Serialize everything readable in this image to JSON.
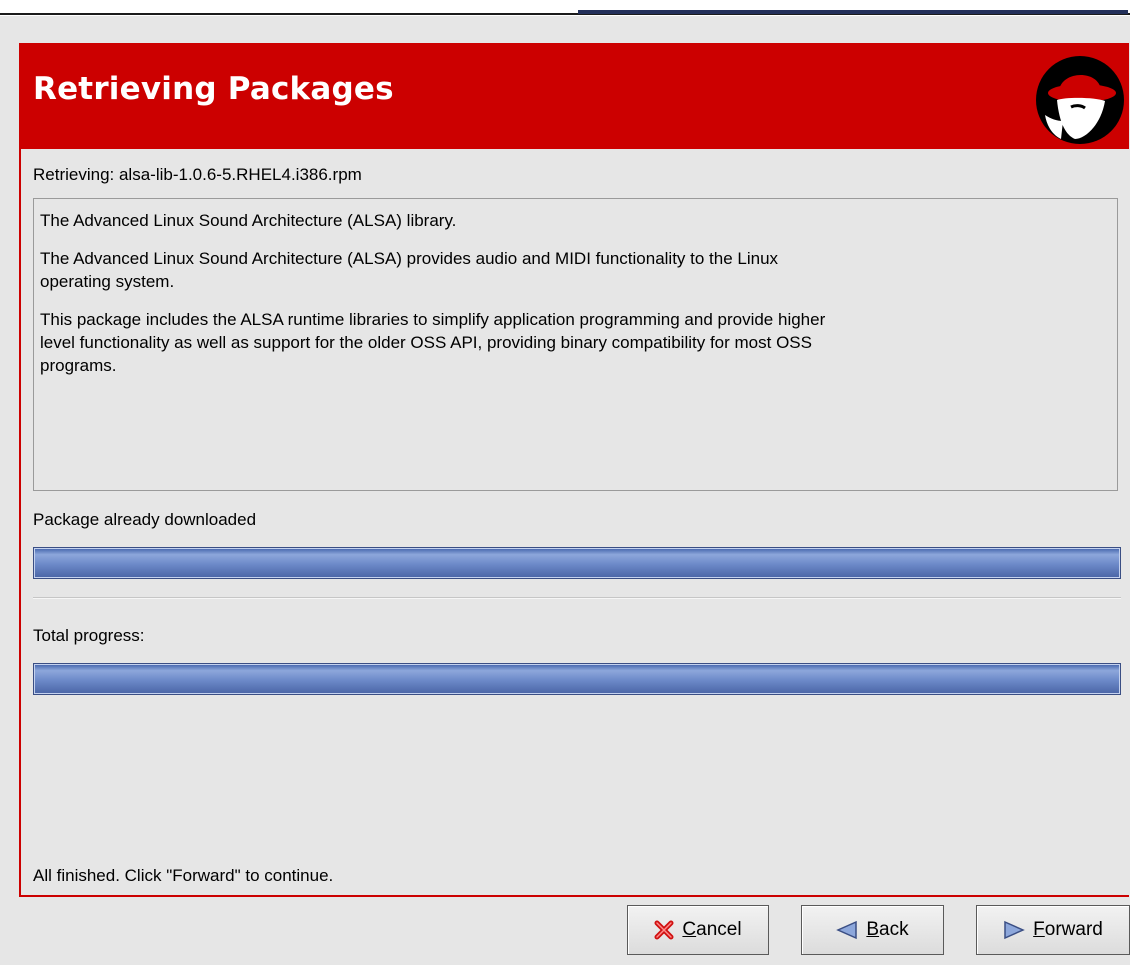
{
  "banner": {
    "title": "Retrieving Packages"
  },
  "retrieving": {
    "text": "Retrieving: alsa-lib-1.0.6-5.RHEL4.i386.rpm"
  },
  "description": {
    "paragraphs": [
      "The Advanced Linux Sound Architecture (ALSA) library.",
      "The Advanced Linux Sound Architecture (ALSA) provides audio and MIDI functionality to the Linux operating system.",
      "This package includes the ALSA runtime libraries to simplify application programming and provide higher level functionality as well as support for the older OSS API, providing binary compatibility for most OSS programs."
    ]
  },
  "package_progress": {
    "label": "Package already downloaded",
    "fraction": 1.0
  },
  "total_progress": {
    "label": "Total progress:",
    "fraction": 1.0
  },
  "status": {
    "text": "All finished.  Click \"Forward\" to continue."
  },
  "buttons": {
    "cancel": {
      "mnemonic": "C",
      "rest": "ancel",
      "icon": "cancel-x-icon"
    },
    "back": {
      "mnemonic": "B",
      "rest": "ack",
      "icon": "back-arrow-icon"
    },
    "forward": {
      "mnemonic": "F",
      "rest": "orward",
      "icon": "forward-arrow-icon"
    }
  },
  "colors": {
    "banner": "#cc0000",
    "progress": "#6c89c8",
    "window": "#e6e6e6"
  }
}
